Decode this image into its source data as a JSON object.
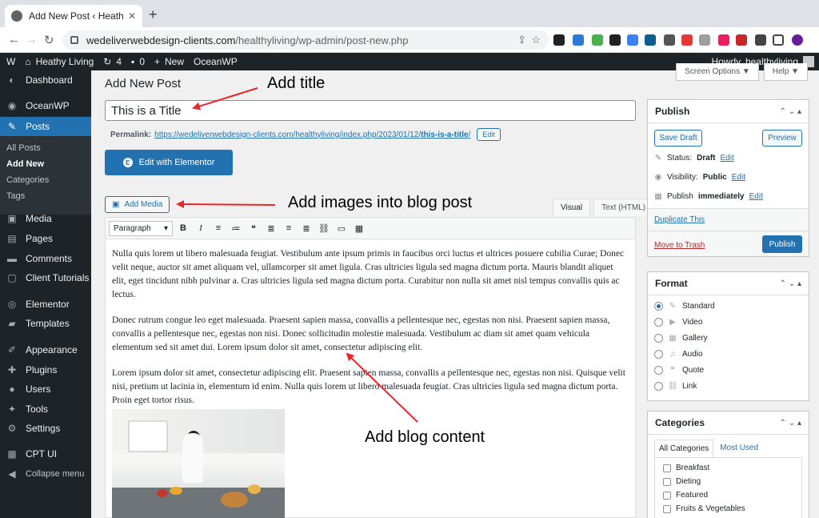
{
  "browser": {
    "tab_title": "Add New Post ‹ Heathy Living",
    "tab_close": "✕",
    "new_tab": "+",
    "back": "←",
    "forward": "→",
    "reload": "↻",
    "url_host": "wedeliverwebdesign-clients.com",
    "url_path": "/healthyliving/wp-admin/post-new.php",
    "share": "⇪",
    "star": "☆"
  },
  "adminbar": {
    "wp_logo": "W",
    "site_name": "Heathy Living",
    "updates_count": "4",
    "comments_count": "0",
    "new_label": "New",
    "theme_label": "OceanWP",
    "howdy": "Howdy, healthyliving"
  },
  "sidebar": {
    "items": [
      {
        "label": "Dashboard",
        "icon": "◐"
      },
      {
        "label": "OceanWP",
        "icon": "◉"
      },
      {
        "label": "Posts",
        "icon": "✎"
      },
      {
        "label": "Media",
        "icon": "▣"
      },
      {
        "label": "Pages",
        "icon": "▤"
      },
      {
        "label": "Comments",
        "icon": "▬"
      },
      {
        "label": "Client Tutorials",
        "icon": "▢"
      },
      {
        "label": "Elementor",
        "icon": "◎"
      },
      {
        "label": "Templates",
        "icon": "▰"
      },
      {
        "label": "Appearance",
        "icon": "✐"
      },
      {
        "label": "Plugins",
        "icon": "✚"
      },
      {
        "label": "Users",
        "icon": "●"
      },
      {
        "label": "Tools",
        "icon": "✦"
      },
      {
        "label": "Settings",
        "icon": "⚙"
      },
      {
        "label": "CPT UI",
        "icon": "▦"
      },
      {
        "label": "Collapse menu",
        "icon": "◀"
      }
    ],
    "submenu": [
      "All Posts",
      "Add New",
      "Categories",
      "Tags"
    ]
  },
  "main": {
    "page_title": "Add New Post",
    "screen_options": "Screen Options ▼",
    "help": "Help ▼",
    "title_value": "This is a Title",
    "permalink_label": "Permalink:",
    "permalink_url_base": "https://wedeliverwebdesign-clients.com/healthyliving/index.php/2023/01/12/",
    "permalink_slug": "this-is-a-title",
    "permalink_tail": "/",
    "permalink_edit": "Edit",
    "elementor_label": "Edit with Elementor",
    "elementor_icon": "E",
    "add_media": "Add Media",
    "tab_visual": "Visual",
    "tab_text": "Text (HTML)",
    "format_select": "Paragraph",
    "toolbar": [
      "B",
      "I",
      "≡",
      "≔",
      "❝",
      "≣",
      "≡",
      "≣",
      "⛓",
      "▭",
      "▦"
    ],
    "paragraphs": [
      "Nulla quis lorem ut libero malesuada feugiat. Vestibulum ante ipsum primis in faucibus orci luctus et ultrices posuere cubilia Curae; Donec velit neque, auctor sit amet aliquam vel, ullamcorper sit amet ligula. Cras ultricies ligula sed magna dictum porta. Mauris blandit aliquet elit, eget tincidunt nibh pulvinar a. Cras ultricies ligula sed magna dictum porta. Curabitur non nulla sit amet nisl tempus convallis quis ac lectus.",
      "Donec rutrum congue leo eget malesuada. Praesent sapien massa, convallis a pellentesque nec, egestas non nisi. Praesent sapien massa, convallis a pellentesque nec, egestas non nisi. Donec sollicitudin molestie malesuada. Vestibulum ac diam sit amet quam vehicula elementum sed sit amet dui. Lorem ipsum dolor sit amet, consectetur adipiscing elit.",
      "Lorem ipsum dolor sit amet, consectetur adipiscing elit. Praesent sapien massa, convallis a pellentesque nec, egestas non nisi. Quisque velit nisi, pretium ut lacinia in, elementum id enim. Nulla quis lorem ut libero malesuada feugiat. Cras ultricies ligula sed magna dictum porta. Proin eget tortor risus."
    ]
  },
  "annotations": {
    "add_title": "Add title",
    "add_images": "Add images into blog post",
    "add_content": "Add blog content"
  },
  "publish": {
    "title": "Publish",
    "controls": "⌃ ⌄ ▴",
    "save_draft": "Save Draft",
    "preview": "Preview",
    "status_label": "Status:",
    "status_value": "Draft",
    "visibility_label": "Visibility:",
    "visibility_value": "Public",
    "publish_label": "Publish",
    "publish_value": "immediately",
    "edit": "Edit",
    "duplicate": "Duplicate This",
    "trash": "Move to Trash",
    "publish_button": "Publish"
  },
  "format": {
    "title": "Format",
    "options": [
      {
        "label": "Standard",
        "icon": "✎"
      },
      {
        "label": "Video",
        "icon": "▶"
      },
      {
        "label": "Gallery",
        "icon": "▦"
      },
      {
        "label": "Audio",
        "icon": "♫"
      },
      {
        "label": "Quote",
        "icon": "❝"
      },
      {
        "label": "Link",
        "icon": "⛓"
      }
    ],
    "selected_index": 0
  },
  "categories": {
    "title": "Categories",
    "tab_all": "All Categories",
    "tab_used": "Most Used",
    "items": [
      "Breakfast",
      "Dieting",
      "Featured",
      "Fruits & Vegetables"
    ]
  },
  "colors": {
    "wp_blue": "#2271b1",
    "admin_dark": "#1d2327",
    "annotation_arrow": "#e8262b"
  }
}
